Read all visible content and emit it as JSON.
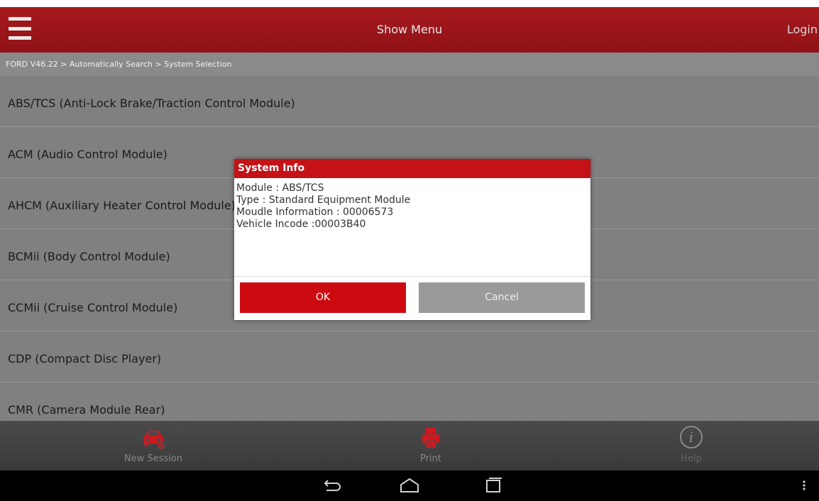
{
  "header": {
    "title": "Show Menu",
    "login_label": "Login"
  },
  "breadcrumb": "FORD V46.22 > Automatically Search > System Selection",
  "systems": [
    "ABS/TCS (Anti-Lock Brake/Traction Control Module)",
    "ACM (Audio Control Module)",
    "AHCM (Auxiliary Heater Control Module)",
    "BCMii (Body Control Module)",
    "CCMii (Cruise Control Module)",
    "CDP (Compact Disc Player)",
    "CMR (Camera Module Rear)"
  ],
  "dialog": {
    "title": "System Info",
    "lines": [
      "Module : ABS/TCS",
      "Type : Standard Equipment Module",
      "Moudle Information : 00006573",
      "Vehicle Incode :00003B40"
    ],
    "ok_label": "OK",
    "cancel_label": "Cancel"
  },
  "bottom_bar": {
    "new_session": "New Session",
    "print": "Print",
    "help": "Help"
  },
  "icons": {
    "menu": "hamburger-icon",
    "new_session": "car-icon",
    "print": "printer-icon",
    "help": "info-icon",
    "back": "back-icon",
    "home": "home-icon",
    "recents": "recents-icon",
    "overflow": "overflow-menu-icon"
  },
  "colors": {
    "brand_red": "#c41217",
    "header_red": "#9e171b"
  }
}
